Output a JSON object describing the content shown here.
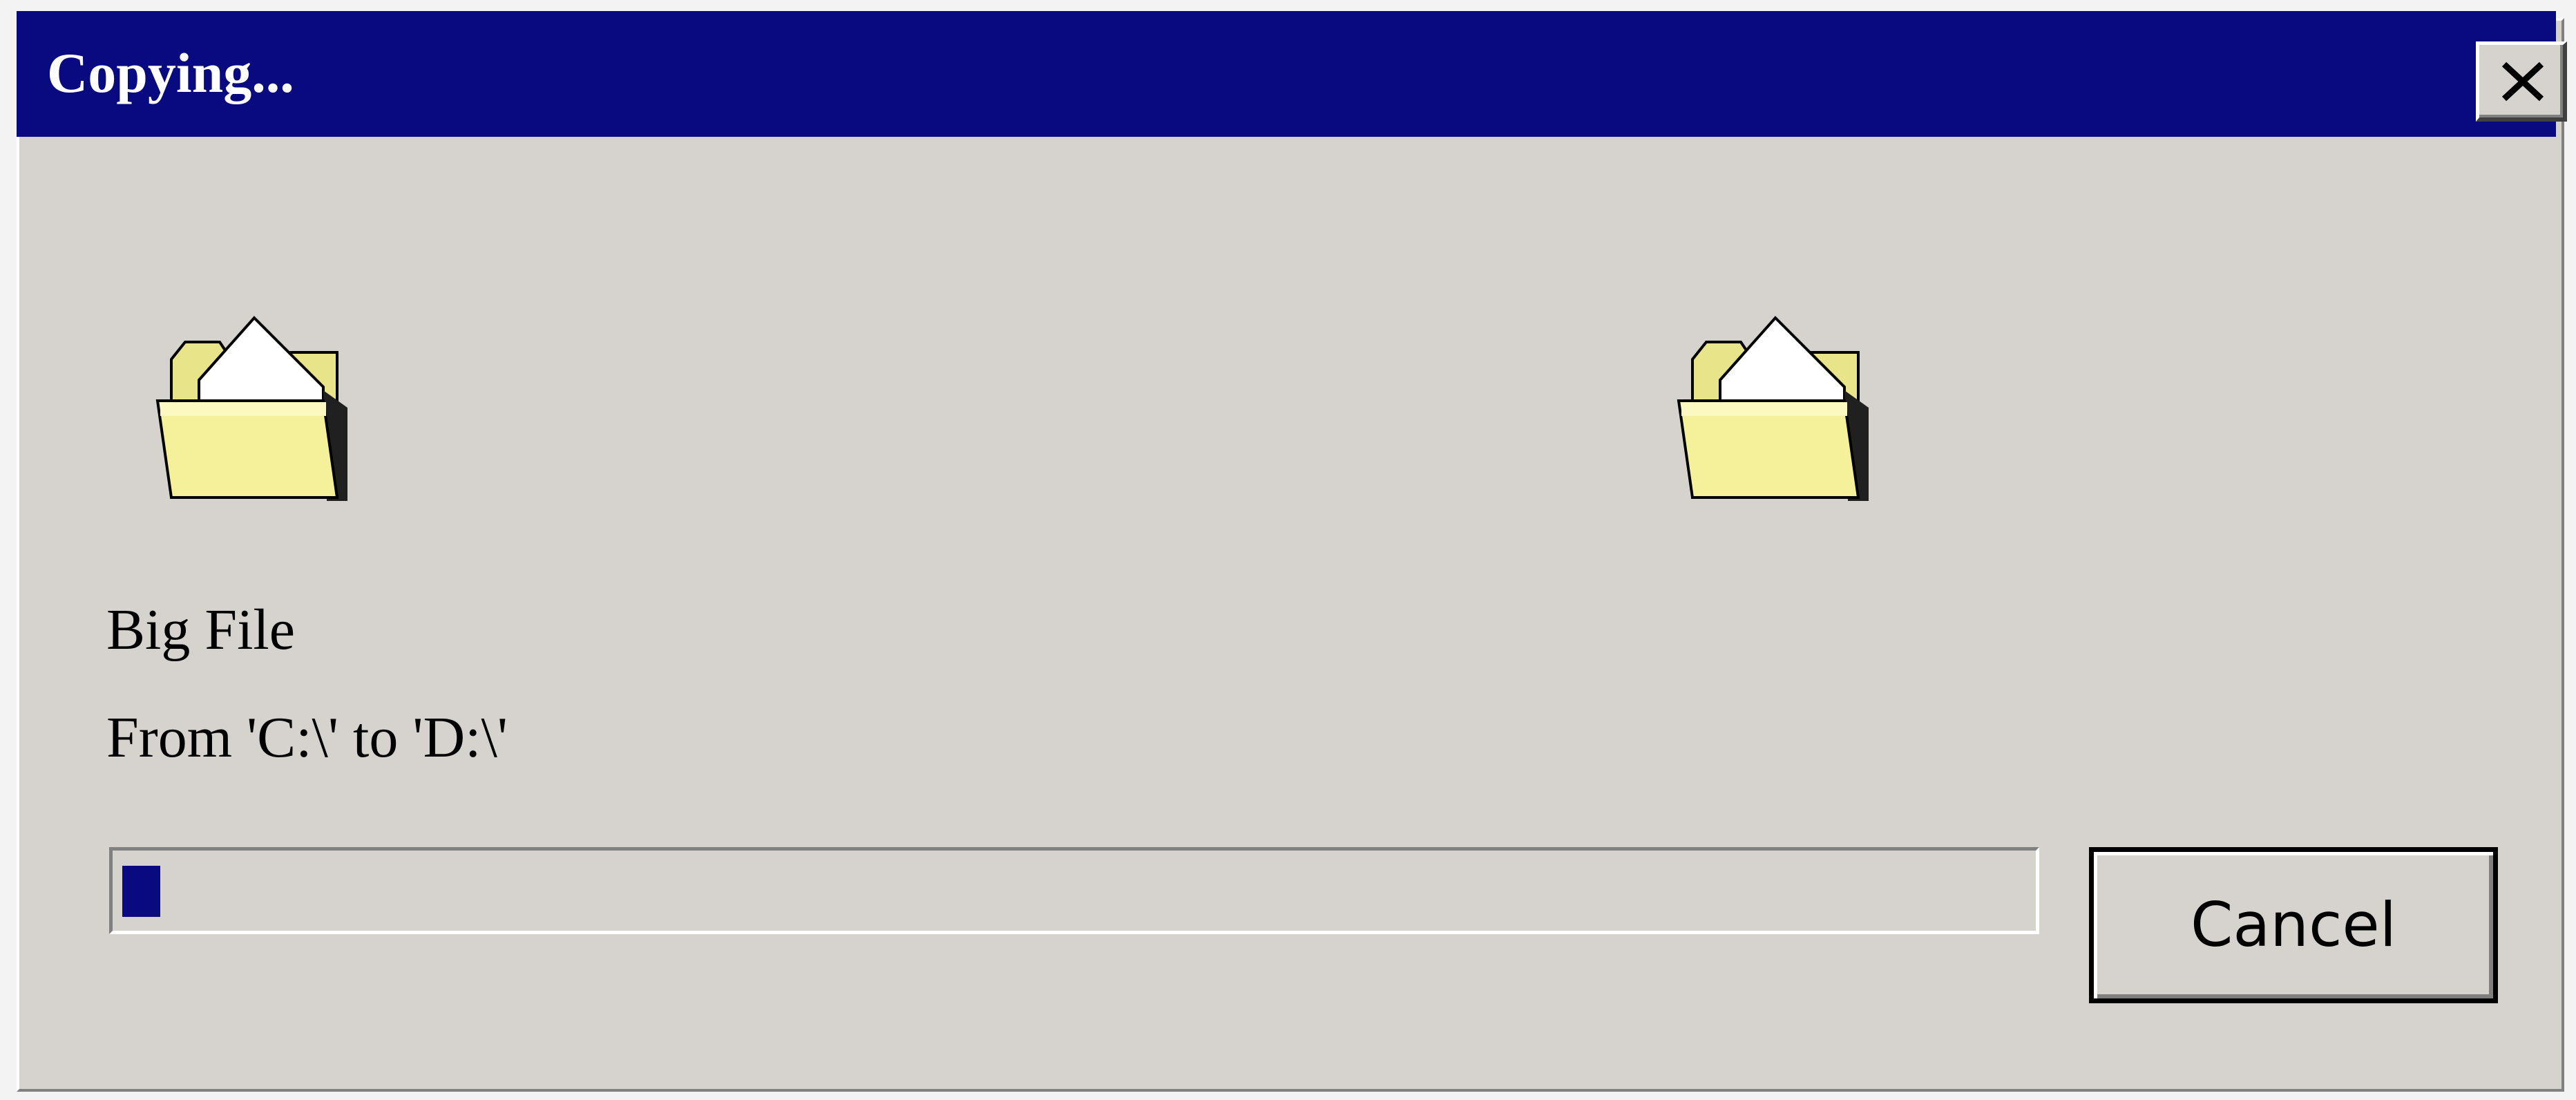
{
  "dialog": {
    "title": "Copying...",
    "close_icon": "close-icon",
    "source_icon": "folder-icon",
    "destination_icon": "folder-icon",
    "file_name": "Big File",
    "path_text": "From 'C:\\' to 'D:\\'",
    "progress_fraction": 0.02,
    "cancel_label": "Cancel"
  },
  "colors": {
    "title_bar": "#0a0a80",
    "window_face": "#d6d3ce",
    "progress_fill": "#0a0a80",
    "folder": "#f5f09a"
  }
}
